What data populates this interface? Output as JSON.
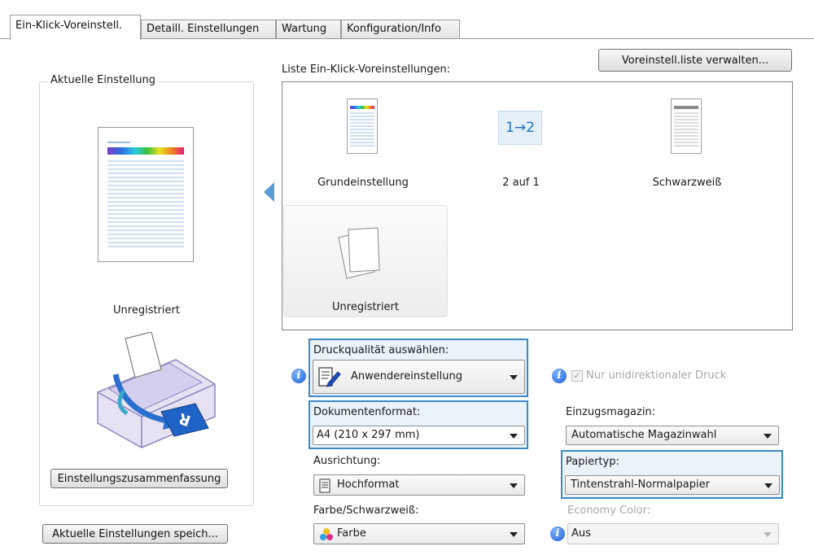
{
  "tabs": [
    {
      "label": "Ein-Klick-Voreinstell.",
      "active": true
    },
    {
      "label": "Detaill. Einstellungen",
      "active": false
    },
    {
      "label": "Wartung",
      "active": false
    },
    {
      "label": "Konfiguration/Info",
      "active": false
    }
  ],
  "current_setting": {
    "group_title": "Aktuelle Einstellung",
    "name": "Unregistriert",
    "summary_button": "Einstellungszusammenfassung"
  },
  "save_button": "Aktuelle Einstellungen speich...",
  "preset_list": {
    "label": "Liste Ein-Klick-Voreinstellungen:",
    "manage_button": "Voreinstell.liste verwalten...",
    "items": [
      {
        "label": "Grundeinstellung",
        "icon": "color-document-icon"
      },
      {
        "label": "2 auf 1",
        "icon": "two-up-icon",
        "glyph": "1→2"
      },
      {
        "label": "Schwarzweiß",
        "icon": "grayscale-document-icon"
      },
      {
        "label": "Unregistriert",
        "icon": "blank-pages-icon",
        "selected": true
      }
    ]
  },
  "print_quality": {
    "label": "Druckqualität auswählen:",
    "value": "Anwendereinstellung",
    "unidirectional_label": "Nur unidirektionaler Druck",
    "unidirectional_checked": true
  },
  "document_format": {
    "label": "Dokumentenformat:",
    "value": "A4 (210 x 297 mm)"
  },
  "paper_source": {
    "label": "Einzugsmagazin:",
    "value": "Automatische Magazinwahl"
  },
  "orientation": {
    "label": "Ausrichtung:",
    "value": "Hochformat"
  },
  "paper_type": {
    "label": "Papiertyp:",
    "value": "Tintenstrahl-Normalpapier"
  },
  "color_mode": {
    "label": "Farbe/Schwarzweiß:",
    "value": "Farbe"
  },
  "economy_color": {
    "label": "Economy Color:",
    "value": "Aus",
    "disabled": true
  },
  "colors": {
    "highlight_border": "#3b8ac4",
    "highlight_fill": "#eaf2fa",
    "selected_arrow": "#5a9ad6"
  }
}
